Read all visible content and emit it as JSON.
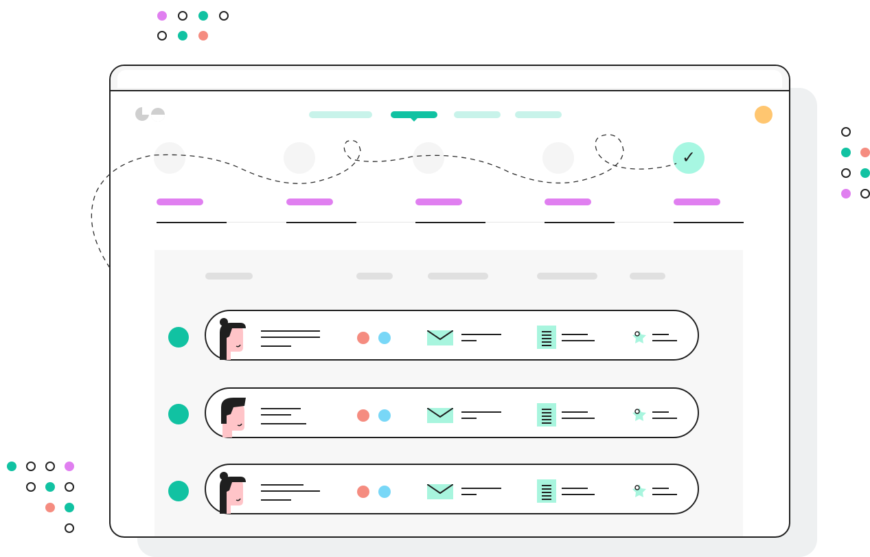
{
  "window": {
    "brand_icon": "eo-logo-icon",
    "nav": {
      "items": 4,
      "active_index": 1
    },
    "avatar_color": "#ffc670"
  },
  "steps": {
    "count": 5,
    "completed_index": 4,
    "check_glyph": "✓",
    "accent_bar_color": "#e07ff0",
    "check_bg_color": "#a7f7e2"
  },
  "table": {
    "rows": [
      {
        "avatar": "woman-avatar-icon",
        "status_color": "#11c2a2",
        "tags": [
          "#f58c80",
          "#78d7f7"
        ]
      },
      {
        "avatar": "man-avatar-icon",
        "status_color": "#11c2a2",
        "tags": [
          "#f58c80",
          "#78d7f7"
        ]
      },
      {
        "avatar": "woman-avatar-icon",
        "status_color": "#11c2a2",
        "tags": [
          "#f58c80",
          "#78d7f7"
        ]
      }
    ],
    "icons": [
      "envelope-icon",
      "document-icon",
      "badge-icon"
    ]
  },
  "colors": {
    "teal": "#11c2a2",
    "mint": "#a8f5de",
    "pink": "#e07ff0",
    "coral": "#f58c80",
    "sky": "#78d7f7",
    "orange": "#ffc670"
  }
}
